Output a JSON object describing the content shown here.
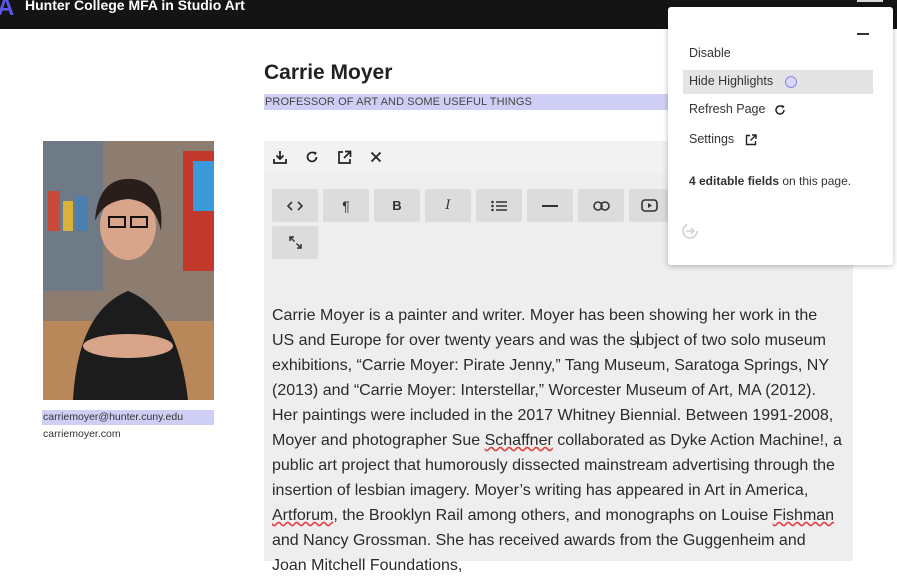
{
  "header": {
    "logo_letter": "A",
    "site_title": "Hunter College MFA in Studio Art"
  },
  "profile": {
    "name": "Carrie Moyer",
    "role": "PROFESSOR OF ART AND SOME USEFUL THINGS",
    "email": "carriemoyer@hunter.cuny.edu",
    "website": "carriemoyer.com"
  },
  "editor": {
    "top_icons": [
      "download-icon",
      "refresh-icon",
      "open-external-icon",
      "close-icon"
    ],
    "toolbar": [
      "code",
      "paragraph",
      "B",
      "I",
      "bulleted-list",
      "horizontal-rule",
      "link",
      "video",
      "fullscreen"
    ],
    "bio": {
      "p1": "Carrie Moyer is a painter and writer. Moyer has been showing her work in the US and Europe for over twenty years and was the s",
      "p2": "ubject of two solo museum exhibitions, “Carrie Moyer: Pirate Jenny,” Tang Museum, Saratoga Springs, NY (2013) and “Carrie Moyer: Interstellar,” Worcester Museum of Art, MA (2012). Her paintings were included in the 2017 Whitney Biennial. Between 1991-2008, Moyer and photographer Sue ",
      "w1": "Schaffner",
      "p3": " collaborated as Dyke Action Machine!, a public art project that humorously dissected mainstream advertising through the insertion of lesbian imagery. Moyer’s writing has appeared in Art in America, ",
      "w2": "Artforum",
      "p4": ", the Brooklyn Rail among others, and monographs on Louise ",
      "w3": "Fishman",
      "p5": " and Nancy Grossman. She has received awards from the Guggenheim and Joan Mitchell Foundations,"
    }
  },
  "popup": {
    "disable": "Disable",
    "hide_highlights": "Hide Highlights",
    "refresh_page": "Refresh Page",
    "settings": "Settings",
    "fields_count": "4 editable fields",
    "fields_suffix": " on this page."
  },
  "colors": {
    "highlight": "#cfcff5",
    "brand": "#5b55e8",
    "topbar": "#141414"
  }
}
